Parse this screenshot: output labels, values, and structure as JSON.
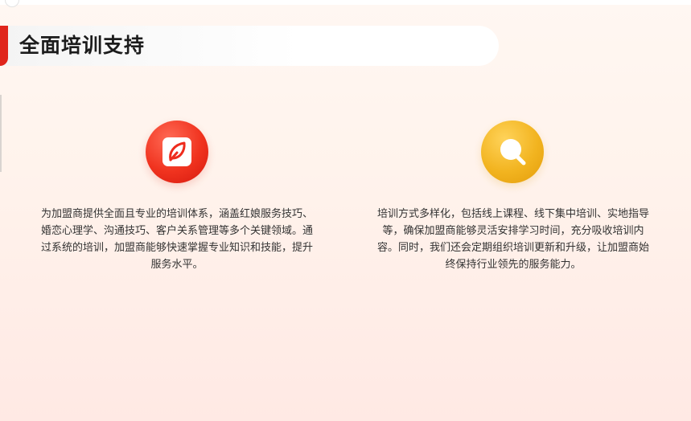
{
  "header": {
    "title": "全面培训支持"
  },
  "features": [
    {
      "icon": "leaf-card-icon",
      "color": "#f0331f",
      "text": "为加盟商提供全面且专业的培训体系，涵盖红娘服务技巧、婚恋心理学、沟通技巧、客户关系管理等多个关键领域。通过系统的培训，加盟商能够快速掌握专业知识和技能，提升服务水平。"
    },
    {
      "icon": "search-icon",
      "color": "#f2b420",
      "text": "培训方式多样化，包括线上课程、线下集中培训、实地指导等，确保加盟商能够灵活安排学习时间，充分吸收培训内容。同时，我们还会定期组织培训更新和升级，让加盟商始终保持行业领先的服务能力。"
    }
  ]
}
